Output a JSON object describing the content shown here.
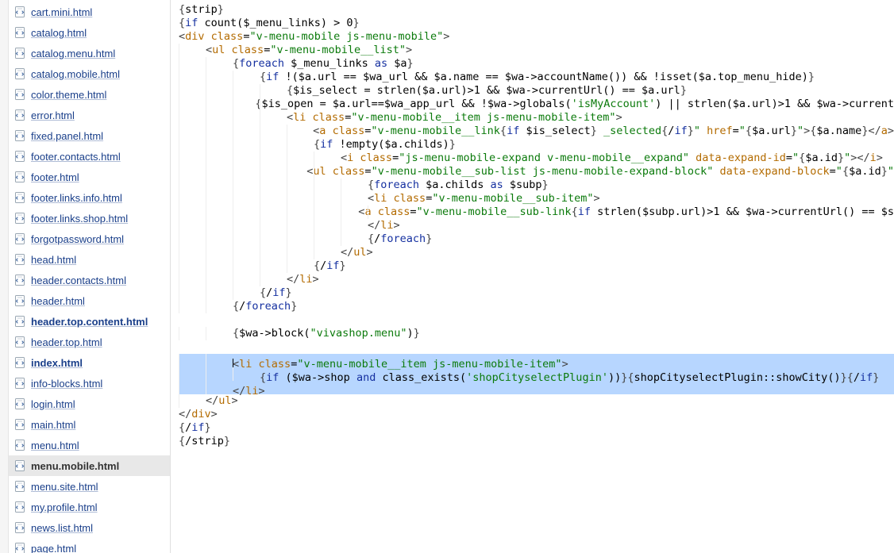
{
  "sidebar": {
    "files": [
      {
        "name": "cart.mini.html",
        "selected": false,
        "bold": false
      },
      {
        "name": "catalog.html",
        "selected": false,
        "bold": false
      },
      {
        "name": "catalog.menu.html",
        "selected": false,
        "bold": false
      },
      {
        "name": "catalog.mobile.html",
        "selected": false,
        "bold": false
      },
      {
        "name": "color.theme.html",
        "selected": false,
        "bold": false
      },
      {
        "name": "error.html",
        "selected": false,
        "bold": false
      },
      {
        "name": "fixed.panel.html",
        "selected": false,
        "bold": false
      },
      {
        "name": "footer.contacts.html",
        "selected": false,
        "bold": false
      },
      {
        "name": "footer.html",
        "selected": false,
        "bold": false
      },
      {
        "name": "footer.links.info.html",
        "selected": false,
        "bold": false
      },
      {
        "name": "footer.links.shop.html",
        "selected": false,
        "bold": false
      },
      {
        "name": "forgotpassword.html",
        "selected": false,
        "bold": false
      },
      {
        "name": "head.html",
        "selected": false,
        "bold": false
      },
      {
        "name": "header.contacts.html",
        "selected": false,
        "bold": false
      },
      {
        "name": "header.html",
        "selected": false,
        "bold": false
      },
      {
        "name": "header.top.content.html",
        "selected": false,
        "bold": true
      },
      {
        "name": "header.top.html",
        "selected": false,
        "bold": false
      },
      {
        "name": "index.html",
        "selected": false,
        "bold": true
      },
      {
        "name": "info-blocks.html",
        "selected": false,
        "bold": false
      },
      {
        "name": "login.html",
        "selected": false,
        "bold": false
      },
      {
        "name": "main.html",
        "selected": false,
        "bold": false
      },
      {
        "name": "menu.html",
        "selected": false,
        "bold": false
      },
      {
        "name": "menu.mobile.html",
        "selected": true,
        "bold": false
      },
      {
        "name": "menu.site.html",
        "selected": false,
        "bold": false
      },
      {
        "name": "my.profile.html",
        "selected": false,
        "bold": false
      },
      {
        "name": "news.list.html",
        "selected": false,
        "bold": false
      },
      {
        "name": "page.html",
        "selected": false,
        "bold": false
      }
    ]
  },
  "editor": {
    "lines": [
      {
        "indent": 0,
        "hl": false,
        "tokens": [
          [
            "pun",
            "{"
          ],
          [
            "plain",
            "strip"
          ],
          [
            "pun",
            "}"
          ]
        ]
      },
      {
        "indent": 0,
        "hl": false,
        "tokens": [
          [
            "pun",
            "{"
          ],
          [
            "kw",
            "if"
          ],
          [
            "plain",
            " count("
          ],
          [
            "plain",
            "$_menu_links"
          ],
          [
            "plain",
            ") > "
          ],
          [
            "plain",
            "0"
          ],
          [
            "pun",
            "}"
          ]
        ]
      },
      {
        "indent": 0,
        "hl": false,
        "tokens": [
          [
            "pun",
            "<"
          ],
          [
            "tag",
            "div"
          ],
          [
            "plain",
            " "
          ],
          [
            "tag",
            "class"
          ],
          [
            "plain",
            "="
          ],
          [
            "str",
            "\"v-menu-mobile js-menu-mobile\""
          ],
          [
            "pun",
            ">"
          ]
        ]
      },
      {
        "indent": 1,
        "hl": false,
        "tokens": [
          [
            "pun",
            "<"
          ],
          [
            "tag",
            "ul"
          ],
          [
            "plain",
            " "
          ],
          [
            "tag",
            "class"
          ],
          [
            "plain",
            "="
          ],
          [
            "str",
            "\"v-menu-mobile__list\""
          ],
          [
            "pun",
            ">"
          ]
        ]
      },
      {
        "indent": 2,
        "hl": false,
        "tokens": [
          [
            "pun",
            "{"
          ],
          [
            "kw",
            "foreach"
          ],
          [
            "plain",
            " $_menu_links "
          ],
          [
            "kw",
            "as"
          ],
          [
            "plain",
            " $a"
          ],
          [
            "pun",
            "}"
          ]
        ]
      },
      {
        "indent": 3,
        "hl": false,
        "tokens": [
          [
            "pun",
            "{"
          ],
          [
            "kw",
            "if"
          ],
          [
            "plain",
            " !($a.url == $wa_url && $a.name == $wa->accountName()) && !isset($a.top_menu_hide)"
          ],
          [
            "pun",
            "}"
          ]
        ]
      },
      {
        "indent": 4,
        "hl": false,
        "tokens": [
          [
            "pun",
            "{"
          ],
          [
            "plain",
            "$is_select = strlen($a.url)>1 && $wa->currentUrl() == $a.url"
          ],
          [
            "pun",
            "}"
          ]
        ]
      },
      {
        "indent": 4,
        "hl": false,
        "tokens": [
          [
            "pun",
            "{"
          ],
          [
            "plain",
            "$is_open = $a.url==$wa_app_url && !$wa->globals("
          ],
          [
            "str",
            "'isMyAccount'"
          ],
          [
            "plain",
            ") || strlen($a.url)>1 && $wa->current"
          ]
        ]
      },
      {
        "indent": 4,
        "hl": false,
        "tokens": [
          [
            "pun",
            "<"
          ],
          [
            "tag",
            "li"
          ],
          [
            "plain",
            " "
          ],
          [
            "tag",
            "class"
          ],
          [
            "plain",
            "="
          ],
          [
            "str",
            "\"v-menu-mobile__item js-menu-mobile-item\""
          ],
          [
            "pun",
            ">"
          ]
        ]
      },
      {
        "indent": 5,
        "hl": false,
        "tokens": [
          [
            "pun",
            "<"
          ],
          [
            "tag",
            "a"
          ],
          [
            "plain",
            " "
          ],
          [
            "tag",
            "class"
          ],
          [
            "plain",
            "="
          ],
          [
            "str",
            "\"v-menu-mobile__link"
          ],
          [
            "pun",
            "{"
          ],
          [
            "kw",
            "if"
          ],
          [
            "plain",
            " $is_select"
          ],
          [
            "pun",
            "}"
          ],
          [
            "str",
            " _selected"
          ],
          [
            "pun",
            "{"
          ],
          [
            "plain",
            "/"
          ],
          [
            "kw",
            "if"
          ],
          [
            "pun",
            "}"
          ],
          [
            "str",
            "\""
          ],
          [
            "plain",
            " "
          ],
          [
            "tag",
            "href"
          ],
          [
            "plain",
            "="
          ],
          [
            "str",
            "\""
          ],
          [
            "pun",
            "{"
          ],
          [
            "plain",
            "$a.url"
          ],
          [
            "pun",
            "}"
          ],
          [
            "str",
            "\""
          ],
          [
            "pun",
            ">"
          ],
          [
            "pun",
            "{"
          ],
          [
            "plain",
            "$a.name"
          ],
          [
            "pun",
            "}"
          ],
          [
            "pun",
            "</"
          ],
          [
            "tag",
            "a"
          ],
          [
            "pun",
            ">"
          ]
        ]
      },
      {
        "indent": 5,
        "hl": false,
        "tokens": [
          [
            "pun",
            "{"
          ],
          [
            "kw",
            "if"
          ],
          [
            "plain",
            " !empty($a.childs)"
          ],
          [
            "pun",
            "}"
          ]
        ]
      },
      {
        "indent": 6,
        "hl": false,
        "tokens": [
          [
            "pun",
            "<"
          ],
          [
            "tag",
            "i"
          ],
          [
            "plain",
            " "
          ],
          [
            "tag",
            "class"
          ],
          [
            "plain",
            "="
          ],
          [
            "str",
            "\"js-menu-mobile-expand v-menu-mobile__expand\""
          ],
          [
            "plain",
            " "
          ],
          [
            "tag",
            "data-expand-id"
          ],
          [
            "plain",
            "="
          ],
          [
            "str",
            "\""
          ],
          [
            "pun",
            "{"
          ],
          [
            "plain",
            "$a.id"
          ],
          [
            "pun",
            "}"
          ],
          [
            "str",
            "\""
          ],
          [
            "pun",
            "></"
          ],
          [
            "tag",
            "i"
          ],
          [
            "pun",
            ">"
          ]
        ]
      },
      {
        "indent": 6,
        "hl": false,
        "tokens": [
          [
            "pun",
            "<"
          ],
          [
            "tag",
            "ul"
          ],
          [
            "plain",
            " "
          ],
          [
            "tag",
            "class"
          ],
          [
            "plain",
            "="
          ],
          [
            "str",
            "\"v-menu-mobile__sub-list js-menu-mobile-expand-block\""
          ],
          [
            "plain",
            " "
          ],
          [
            "tag",
            "data-expand-block"
          ],
          [
            "plain",
            "="
          ],
          [
            "str",
            "\""
          ],
          [
            "pun",
            "{"
          ],
          [
            "plain",
            "$a.id"
          ],
          [
            "pun",
            "}"
          ],
          [
            "str",
            "\""
          ]
        ]
      },
      {
        "indent": 7,
        "hl": false,
        "tokens": [
          [
            "pun",
            "{"
          ],
          [
            "kw",
            "foreach"
          ],
          [
            "plain",
            " $a.childs "
          ],
          [
            "kw",
            "as"
          ],
          [
            "plain",
            " $subp"
          ],
          [
            "pun",
            "}"
          ]
        ]
      },
      {
        "indent": 7,
        "hl": false,
        "tokens": [
          [
            "pun",
            "<"
          ],
          [
            "tag",
            "li"
          ],
          [
            "plain",
            " "
          ],
          [
            "tag",
            "class"
          ],
          [
            "plain",
            "="
          ],
          [
            "str",
            "\"v-menu-mobile__sub-item\""
          ],
          [
            "pun",
            ">"
          ]
        ]
      },
      {
        "indent": 8,
        "hl": false,
        "tokens": [
          [
            "pun",
            "<"
          ],
          [
            "tag",
            "a"
          ],
          [
            "plain",
            " "
          ],
          [
            "tag",
            "class"
          ],
          [
            "plain",
            "="
          ],
          [
            "str",
            "\"v-menu-mobile__sub-link"
          ],
          [
            "pun",
            "{"
          ],
          [
            "kw",
            "if"
          ],
          [
            "plain",
            " strlen($subp.url)>1 && $wa->currentUrl() == $s"
          ]
        ]
      },
      {
        "indent": 7,
        "hl": false,
        "tokens": [
          [
            "pun",
            "</"
          ],
          [
            "tag",
            "li"
          ],
          [
            "pun",
            ">"
          ]
        ]
      },
      {
        "indent": 7,
        "hl": false,
        "tokens": [
          [
            "pun",
            "{"
          ],
          [
            "plain",
            "/"
          ],
          [
            "kw",
            "foreach"
          ],
          [
            "pun",
            "}"
          ]
        ]
      },
      {
        "indent": 6,
        "hl": false,
        "tokens": [
          [
            "pun",
            "</"
          ],
          [
            "tag",
            "ul"
          ],
          [
            "pun",
            ">"
          ]
        ]
      },
      {
        "indent": 5,
        "hl": false,
        "tokens": [
          [
            "pun",
            "{"
          ],
          [
            "plain",
            "/"
          ],
          [
            "kw",
            "if"
          ],
          [
            "pun",
            "}"
          ]
        ]
      },
      {
        "indent": 4,
        "hl": false,
        "tokens": [
          [
            "pun",
            "</"
          ],
          [
            "tag",
            "li"
          ],
          [
            "pun",
            ">"
          ]
        ]
      },
      {
        "indent": 3,
        "hl": false,
        "tokens": [
          [
            "pun",
            "{"
          ],
          [
            "plain",
            "/"
          ],
          [
            "kw",
            "if"
          ],
          [
            "pun",
            "}"
          ]
        ]
      },
      {
        "indent": 2,
        "hl": false,
        "tokens": [
          [
            "pun",
            "{"
          ],
          [
            "plain",
            "/"
          ],
          [
            "kw",
            "foreach"
          ],
          [
            "pun",
            "}"
          ]
        ]
      },
      {
        "indent": 0,
        "hl": false,
        "tokens": []
      },
      {
        "indent": 2,
        "hl": false,
        "tokens": [
          [
            "pun",
            "{"
          ],
          [
            "plain",
            "$wa->block("
          ],
          [
            "str",
            "\"vivashop.menu\""
          ],
          [
            "plain",
            ")"
          ],
          [
            "pun",
            "}"
          ]
        ]
      },
      {
        "indent": 0,
        "hl": false,
        "tokens": []
      },
      {
        "indent": 2,
        "hl": true,
        "cursor": true,
        "tokens": [
          [
            "pun",
            "<"
          ],
          [
            "tag",
            "li"
          ],
          [
            "plain",
            " "
          ],
          [
            "tag",
            "class"
          ],
          [
            "plain",
            "="
          ],
          [
            "str",
            "\"v-menu-mobile__item js-menu-mobile-item\""
          ],
          [
            "pun",
            ">"
          ]
        ]
      },
      {
        "indent": 3,
        "hl": true,
        "tokens": [
          [
            "pun",
            "{"
          ],
          [
            "kw",
            "if"
          ],
          [
            "plain",
            " ($wa->shop "
          ],
          [
            "kw",
            "and"
          ],
          [
            "plain",
            " class_exists("
          ],
          [
            "str",
            "'shopCityselectPlugin'"
          ],
          [
            "plain",
            "))"
          ],
          [
            "pun",
            "}{"
          ],
          [
            "plain",
            "shopCityselectPlugin::showCity()"
          ],
          [
            "pun",
            "}{"
          ],
          [
            "plain",
            "/"
          ],
          [
            "kw",
            "if"
          ],
          [
            "pun",
            "}"
          ]
        ]
      },
      {
        "indent": 2,
        "hl": true,
        "tokens": [
          [
            "pun",
            "</"
          ],
          [
            "tag",
            "li"
          ],
          [
            "pun",
            ">"
          ]
        ]
      },
      {
        "indent": 1,
        "hl": false,
        "tokens": [
          [
            "pun",
            "</"
          ],
          [
            "tag",
            "ul"
          ],
          [
            "pun",
            ">"
          ]
        ]
      },
      {
        "indent": 0,
        "hl": false,
        "tokens": [
          [
            "pun",
            "</"
          ],
          [
            "tag",
            "div"
          ],
          [
            "pun",
            ">"
          ]
        ]
      },
      {
        "indent": 0,
        "hl": false,
        "tokens": [
          [
            "pun",
            "{"
          ],
          [
            "plain",
            "/"
          ],
          [
            "kw",
            "if"
          ],
          [
            "pun",
            "}"
          ]
        ]
      },
      {
        "indent": 0,
        "hl": false,
        "tokens": [
          [
            "pun",
            "{"
          ],
          [
            "plain",
            "/strip"
          ],
          [
            "pun",
            "}"
          ]
        ]
      }
    ],
    "indent_width": 34
  }
}
